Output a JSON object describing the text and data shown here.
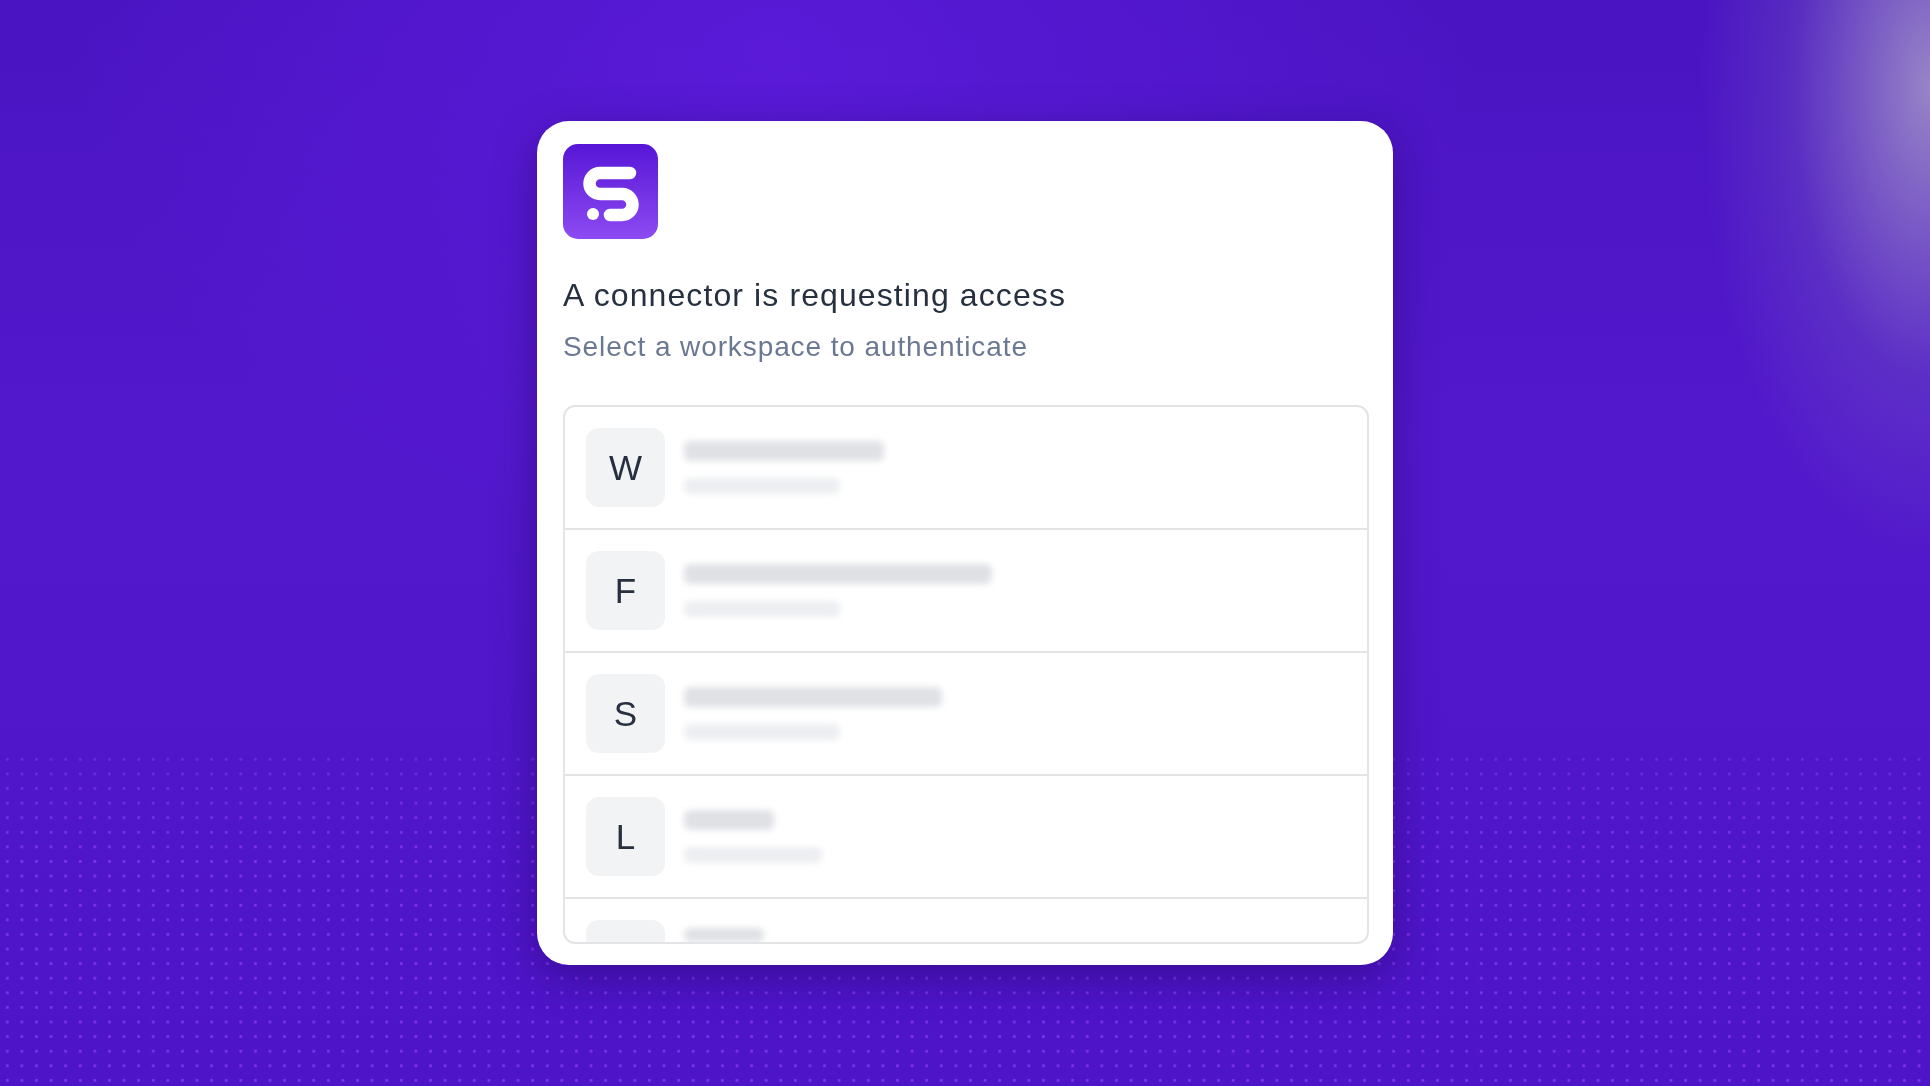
{
  "dialog": {
    "title": "A connector is requesting access",
    "subtitle": "Select a workspace to authenticate"
  },
  "workspaces": {
    "rows": [
      {
        "initial": "W"
      },
      {
        "initial": "F"
      },
      {
        "initial": "S"
      },
      {
        "initial": "L"
      }
    ],
    "cut_off_row": true
  }
}
